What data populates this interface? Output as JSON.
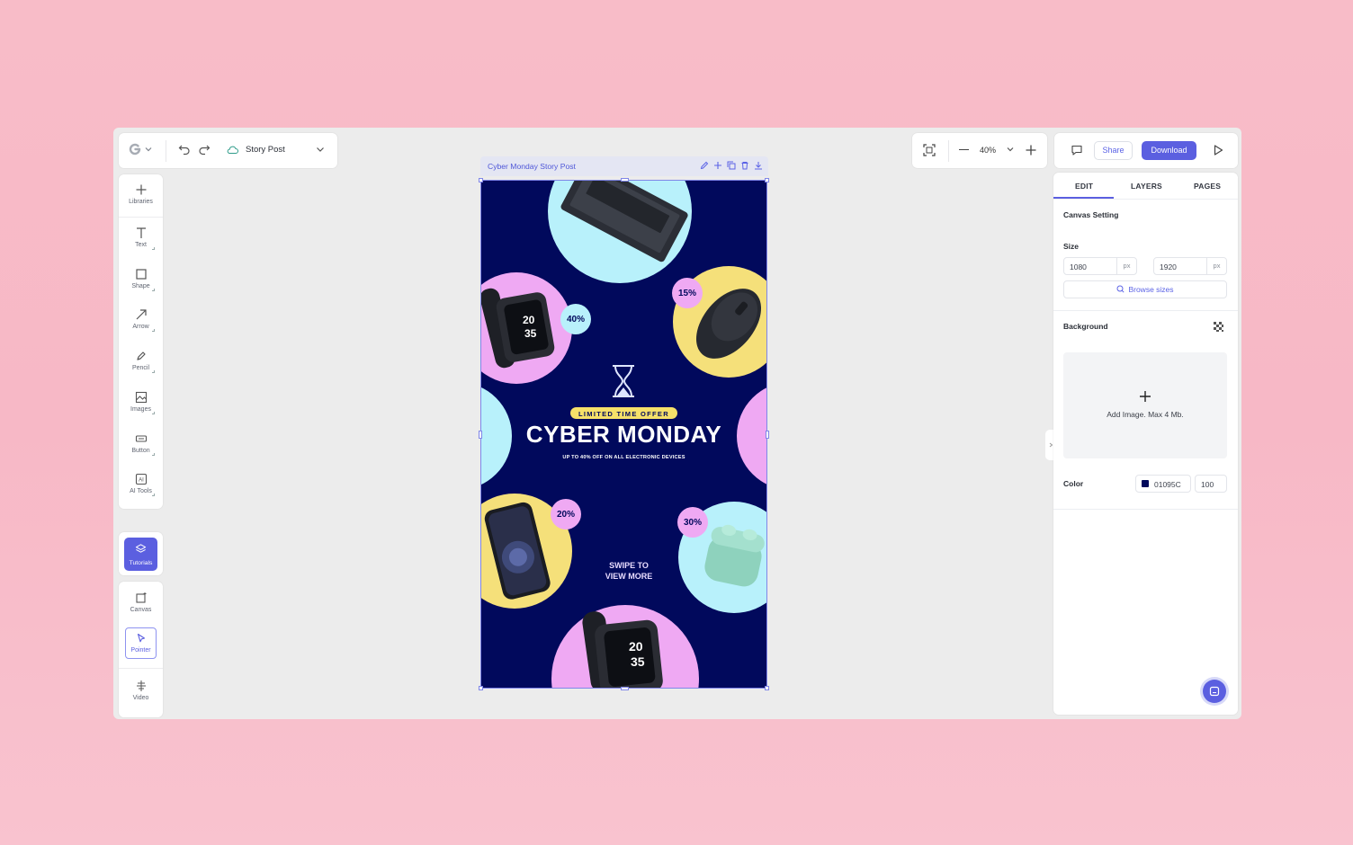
{
  "header": {
    "doc_title": "Story Post"
  },
  "zoom": {
    "value": "40%"
  },
  "actions": {
    "share_label": "Share",
    "download_label": "Download"
  },
  "toolbar": {
    "items": [
      {
        "label": "Libraries",
        "icon": "plus-icon"
      },
      {
        "label": "Text",
        "icon": "text-icon"
      },
      {
        "label": "Shape",
        "icon": "square-icon"
      },
      {
        "label": "Arrow",
        "icon": "arrow-icon"
      },
      {
        "label": "Pencil",
        "icon": "pencil-icon"
      },
      {
        "label": "Images",
        "icon": "image-icon"
      },
      {
        "label": "Button",
        "icon": "button-icon"
      },
      {
        "label": "AI Tools",
        "icon": "ai-icon"
      }
    ],
    "tutorials_label": "Tutorials",
    "canvas_label": "Canvas",
    "pointer_label": "Pointer",
    "video_label": "Video"
  },
  "frame": {
    "title": "Cyber Monday Story Post"
  },
  "design": {
    "badge": "LIMITED TIME OFFER",
    "headline": "CYBER MONDAY",
    "subline": "UP TO 40% OFF ON ALL ELECTRONIC DEVICES",
    "swipe_line1": "SWIPE TO",
    "swipe_line2": "VIEW MORE",
    "discounts": {
      "watch": "40%",
      "mouse": "15%",
      "phone": "20%",
      "earbuds": "30%"
    },
    "watch_time_top": "20",
    "watch_time_bottom": "35",
    "colors": {
      "background": "#01095c",
      "cyan": "#b8f1fb",
      "pink": "#efa9f3",
      "yellow": "#f5e07a"
    }
  },
  "panel": {
    "tabs": [
      "EDIT",
      "LAYERS",
      "PAGES"
    ],
    "section_title": "Canvas Setting",
    "size_label": "Size",
    "width": "1080",
    "height": "1920",
    "unit": "px",
    "browse_label": "Browse sizes",
    "background_label": "Background",
    "add_image_label": "Add Image. Max 4 Mb.",
    "color_label": "Color",
    "color_hex": "01095C",
    "opacity": "100",
    "accent": "#5b5fe0"
  }
}
